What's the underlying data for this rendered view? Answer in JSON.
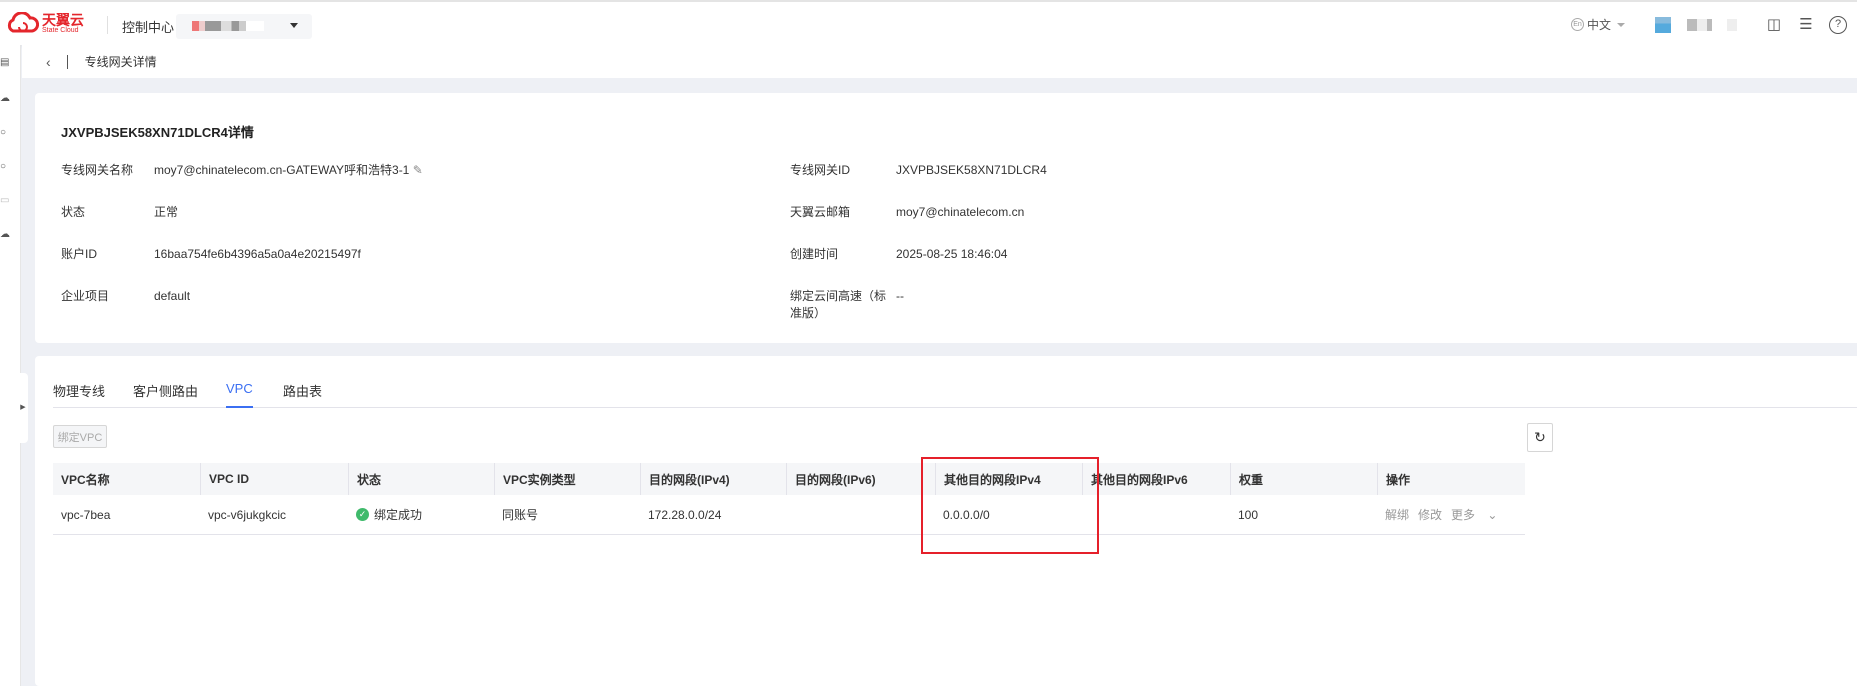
{
  "header": {
    "logo_cn": "天翼云",
    "logo_en": "State Cloud",
    "console": "控制中心",
    "lang": "中文",
    "lang_icon": "En"
  },
  "breadcrumb": {
    "title": "专线网关详情"
  },
  "detail": {
    "title": "JXVPBJSEK58XN71DLCR4详情",
    "fields": [
      {
        "label": "专线网关名称",
        "value": "moy7@chinatelecom.cn-GATEWAY呼和浩特3-1"
      },
      {
        "label": "专线网关ID",
        "value": "JXVPBJSEK58XN71DLCR4"
      },
      {
        "label": "状态",
        "value": "正常"
      },
      {
        "label": "天翼云邮箱",
        "value": "moy7@chinatelecom.cn"
      },
      {
        "label": "账户ID",
        "value": "16baa754fe6b4396a5a0a4e20215497f"
      },
      {
        "label": "创建时间",
        "value": "2025-08-25 18:46:04"
      },
      {
        "label": "企业项目",
        "value": "default"
      },
      {
        "label": "绑定云间高速（标准版）",
        "value": "--"
      }
    ]
  },
  "tabs": [
    "物理专线",
    "客户侧路由",
    "VPC",
    "路由表"
  ],
  "active_tab": "VPC",
  "bind_button": "绑定VPC",
  "table": {
    "columns": [
      "VPC名称",
      "VPC ID",
      "状态",
      "VPC实例类型",
      "目的网段(IPv4)",
      "目的网段(IPv6)",
      "其他目的网段IPv4",
      "其他目的网段IPv6",
      "权重",
      "操作"
    ],
    "rows": [
      {
        "name": "vpc-7bea",
        "id": "vpc-v6jukgkcic",
        "status": "绑定成功",
        "type": "同账号",
        "ipv4": "172.28.0.0/24",
        "ipv6": "",
        "other_ipv4": "0.0.0.0/0",
        "other_ipv6": "",
        "weight": "100",
        "actions": [
          "解绑",
          "修改",
          "更多"
        ]
      }
    ]
  },
  "colors": {
    "accent": "#3b6ff2",
    "success": "#3fba6b",
    "brand": "#e4262c",
    "annotation": "#e5202a"
  }
}
